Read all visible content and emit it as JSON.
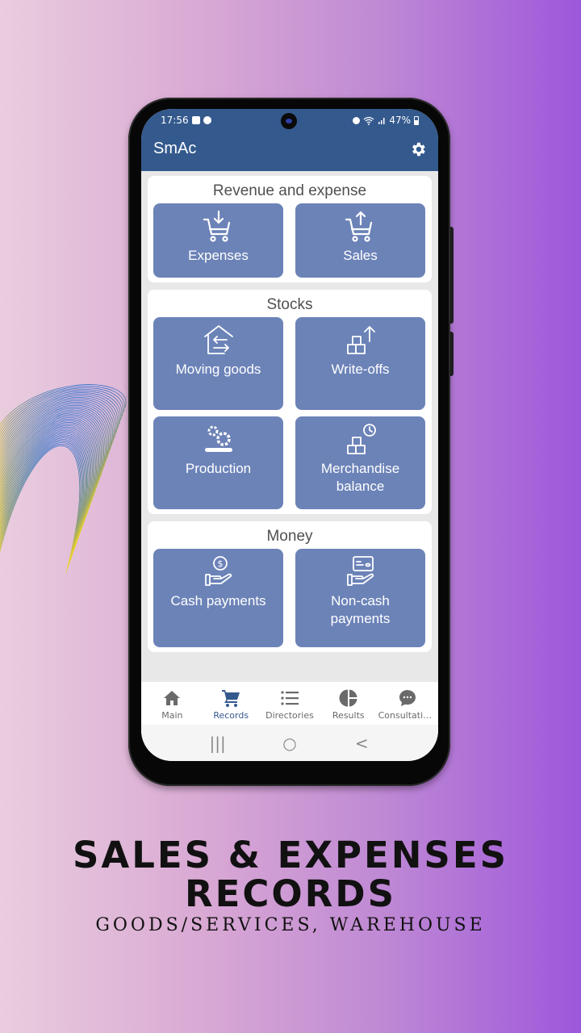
{
  "status_bar": {
    "time": "17:56",
    "battery": "47%"
  },
  "app": {
    "title": "SmAc",
    "settings_icon": "gear-icon"
  },
  "sections": [
    {
      "title": "Revenue and expense",
      "tiles": [
        {
          "label": "Expenses",
          "icon": "cart-in-icon"
        },
        {
          "label": "Sales",
          "icon": "cart-out-icon"
        }
      ]
    },
    {
      "title": "Stocks",
      "tiles": [
        {
          "label": "Moving goods",
          "icon": "warehouse-transfer-icon"
        },
        {
          "label": "Write-offs",
          "icon": "boxes-up-icon"
        },
        {
          "label": "Production",
          "icon": "gears-icon"
        },
        {
          "label": "Merchandise balance",
          "icon": "boxes-clock-icon"
        }
      ]
    },
    {
      "title": "Money",
      "tiles": [
        {
          "label": "Cash payments",
          "icon": "hand-coin-icon"
        },
        {
          "label": "Non-cash payments",
          "icon": "hand-card-icon"
        }
      ]
    }
  ],
  "bottom_nav": [
    {
      "label": "Main",
      "icon": "home-icon",
      "active": false
    },
    {
      "label": "Records",
      "icon": "cart-icon",
      "active": true
    },
    {
      "label": "Directories",
      "icon": "list-icon",
      "active": false
    },
    {
      "label": "Results",
      "icon": "pie-chart-icon",
      "active": false
    },
    {
      "label": "Consultatio...",
      "icon": "chat-icon",
      "active": false
    }
  ],
  "system_nav": {
    "recents": "|||",
    "home": "○",
    "back": "<"
  },
  "colors": {
    "app_bar": "#34598d",
    "tile": "#6c83b8",
    "active_nav": "#34598d"
  },
  "promo": {
    "headline_line1": "SALES & EXPENSES",
    "headline_line2": "RECORDS",
    "subheadline": "GOODS/SERVICES, WAREHOUSE"
  }
}
